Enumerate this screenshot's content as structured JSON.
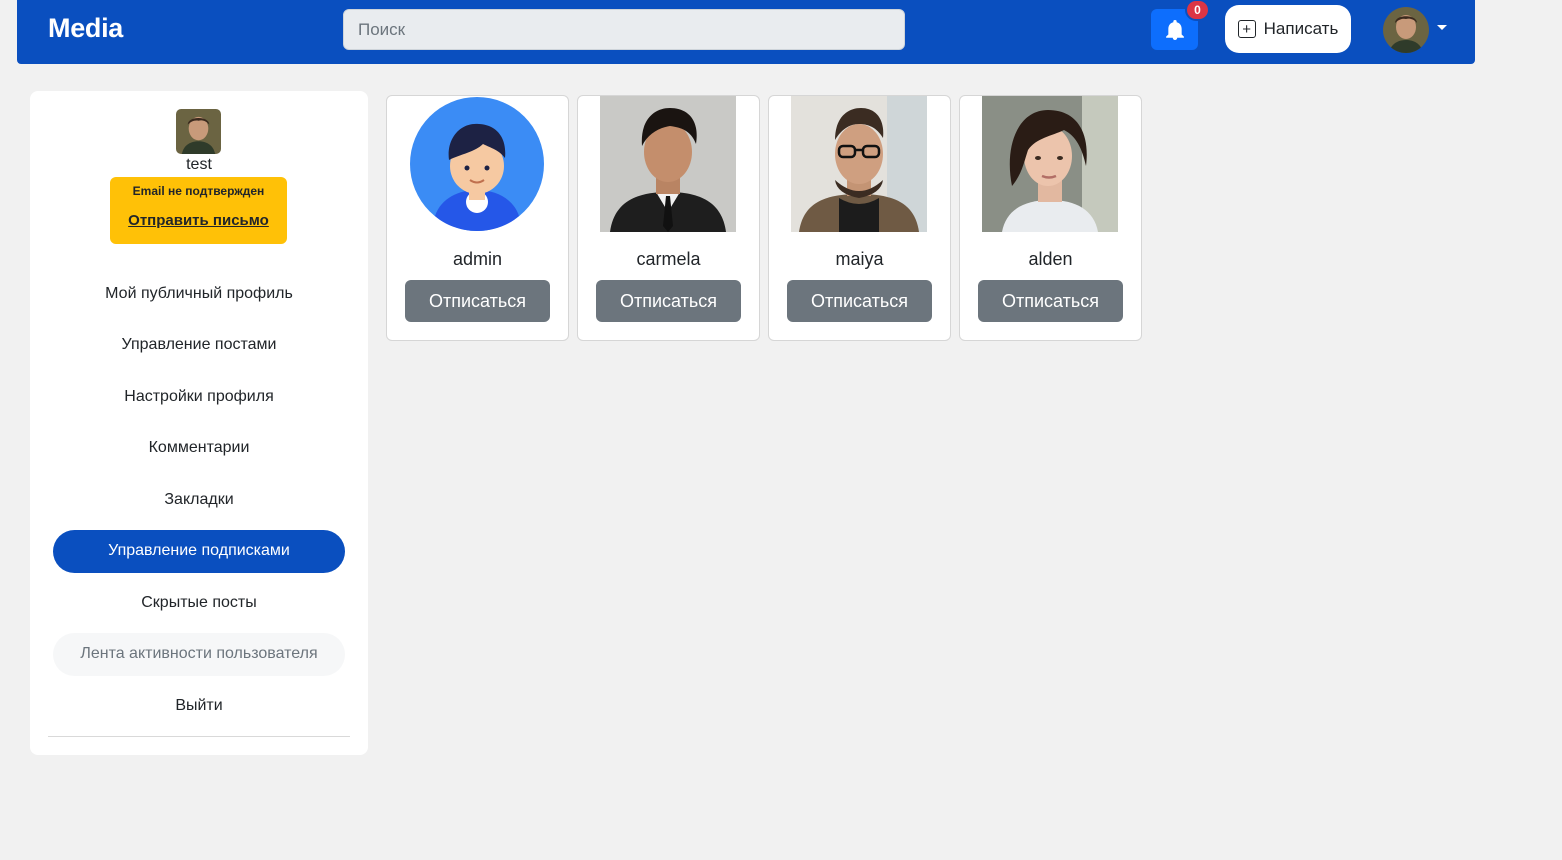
{
  "navbar": {
    "brand": "Media",
    "search_placeholder": "Поиск",
    "notifications_count": "0",
    "write_label": "Написать"
  },
  "sidebar": {
    "username": "test",
    "email_warning": "Email не подтвержден",
    "send_email_label": "Отправить письмо",
    "items": [
      {
        "label": "Мой публичный профиль"
      },
      {
        "label": "Управление постами"
      },
      {
        "label": "Настройки профиля"
      },
      {
        "label": "Комментарии"
      },
      {
        "label": "Закладки"
      },
      {
        "label": "Управление подписками",
        "active": true
      },
      {
        "label": "Скрытые посты"
      },
      {
        "label": "Лента активности пользователя",
        "disabled": true
      },
      {
        "label": "Выйти"
      }
    ]
  },
  "subscriptions": [
    {
      "name": "admin",
      "button": "Отписаться"
    },
    {
      "name": "carmela",
      "button": "Отписаться"
    },
    {
      "name": "maiya",
      "button": "Отписаться"
    },
    {
      "name": "alden",
      "button": "Отписаться"
    }
  ],
  "colors": {
    "navbar": "#0a4fbf",
    "active_menu": "#0a4fbf",
    "warning": "#ffc107",
    "badge": "#dc3545",
    "unsubscribe_button": "#6c757d"
  }
}
